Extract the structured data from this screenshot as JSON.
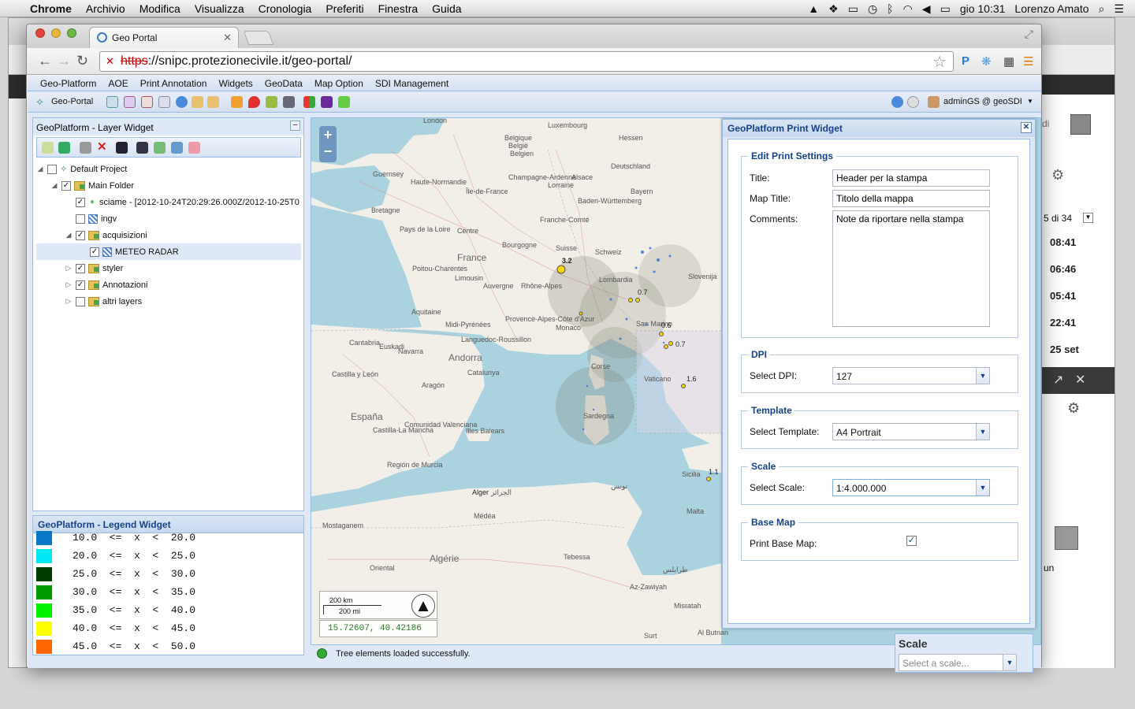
{
  "macmenu": {
    "app": "Chrome",
    "items": [
      "Archivio",
      "Modifica",
      "Visualizza",
      "Cronologia",
      "Preferiti",
      "Finestra",
      "Guida"
    ],
    "clock": "gio 10:31",
    "user": "Lorenzo Amato"
  },
  "browser": {
    "tab_title": "Geo Portal",
    "url_scheme": "https",
    "url_rest": "://snipc.protezionecivile.it/geo-portal/"
  },
  "menubar": [
    "Geo-Platform",
    "AOE",
    "Print Annotation",
    "Widgets",
    "GeoData",
    "Map Option",
    "SDI Management"
  ],
  "toolbar": {
    "home_label": "Geo-Portal",
    "user_label": "adminGS @ geoSDI"
  },
  "layer_widget": {
    "title": "GeoPlatform - Layer Widget",
    "tree": [
      {
        "label": "Default Project",
        "level": 0,
        "expanded": true,
        "checked": false,
        "kind": "project"
      },
      {
        "label": "Main Folder",
        "level": 1,
        "expanded": true,
        "checked": true,
        "kind": "folder"
      },
      {
        "label": "sciame - [2012-10-24T20:29:26.000Z/2012-10-25T0",
        "level": 2,
        "checked": true,
        "kind": "point"
      },
      {
        "label": "ingv",
        "level": 2,
        "checked": false,
        "kind": "layer"
      },
      {
        "label": "acquisizioni",
        "level": 2,
        "expanded": true,
        "checked": true,
        "kind": "folder"
      },
      {
        "label": "METEO RADAR",
        "level": 3,
        "checked": true,
        "kind": "layer",
        "selected": true
      },
      {
        "label": "styler",
        "level": 2,
        "expanded": false,
        "checked": true,
        "kind": "folder"
      },
      {
        "label": "Annotazioni",
        "level": 2,
        "expanded": false,
        "checked": true,
        "kind": "folder"
      },
      {
        "label": "altri layers",
        "level": 2,
        "expanded": false,
        "checked": false,
        "kind": "folder"
      }
    ]
  },
  "legend": {
    "title": "GeoPlatform - Legend Widget",
    "rows": [
      {
        "text": "10.0  <=  x  <  20.0",
        "color": "#0a78c8"
      },
      {
        "text": "20.0  <=  x  <  25.0",
        "color": "#00e8f8"
      },
      {
        "text": "25.0  <=  x  <  30.0",
        "color": "#003c00"
      },
      {
        "text": "30.0  <=  x  <  35.0",
        "color": "#009a00"
      },
      {
        "text": "35.0  <=  x  <  40.0",
        "color": "#00f000"
      },
      {
        "text": "40.0  <=  x  <  45.0",
        "color": "#ffff00"
      },
      {
        "text": "45.0  <=  x  <  50.0",
        "color": "#ff6600"
      }
    ]
  },
  "map": {
    "coords": "15.72607, 40.42186",
    "scale_km": "200 km",
    "scale_mi": "200 mi",
    "labels": [
      "London",
      "Belgique",
      "België",
      "Belgien",
      "Guernsey",
      "Bretagne",
      "France",
      "Pays de la Loire",
      "Centre",
      "Bourgogne",
      "Limousin",
      "Aquitaine",
      "Auvergne",
      "Midi-Pyrénées",
      "Rhône-Alpes",
      "Provence-Alpes-Côte d'Azur",
      "Monaco",
      "Andorra",
      "Catalunya",
      "Cantabria",
      "Euskadi",
      "Navarra",
      "Castilla y León",
      "Aragón",
      "España",
      "Comunidad Valenciana",
      "Illes Balears",
      "Castilla-La Mancha",
      "Región de Murcia",
      "Corse",
      "Sardegna",
      "Lombardia",
      "Bayern",
      "Deutschland",
      "Suisse",
      "Schweiz",
      "Slovenija",
      "San Marino",
      "Vaticano",
      "Sicilia",
      "Malta",
      "Alger",
      "الجزائر",
      "تونس",
      "Algérie",
      "Tebessa",
      "Mostaganem",
      "Oriental",
      "Médéa",
      "Az-Zawiyah",
      "طرابلس",
      "Misratah",
      "Surt",
      "Al Butnan",
      "Baden-Württemberg",
      "Luxembourg",
      "Hessen",
      "Haute-Normandie",
      "Île-de-France",
      "Champagne-Ardenne",
      "Lorraine",
      "Alsace",
      "Franche-Comté",
      "Poitou-Charentes",
      "Languedoc-Roussillon"
    ],
    "quakes": [
      "3.2",
      "0.7",
      "0.6",
      "0.7",
      "1.6",
      "1.1"
    ]
  },
  "print_widget": {
    "title": "GeoPlatform Print Widget",
    "edit_legend": "Edit Print Settings",
    "title_label": "Title:",
    "title_value": "Header per la stampa",
    "maptitle_label": "Map Title:",
    "maptitle_value": "Titolo della mappa",
    "comments_label": "Comments:",
    "comments_value": "Note da riportare nella stampa",
    "dpi_legend": "DPI",
    "dpi_label": "Select DPI:",
    "dpi_value": "127",
    "template_legend": "Template",
    "template_label": "Select Template:",
    "template_value": "A4 Portrait",
    "scale_legend": "Scale",
    "scale_label": "Select Scale:",
    "scale_value": "1:4.000.000",
    "basemap_legend": "Base Map",
    "basemap_label": "Print Base Map:",
    "basemap_checked": true
  },
  "scale_panel": {
    "title": "Scale",
    "placeholder": "Select a scale..."
  },
  "status": "Tree elements loaded successfully.",
  "gmail": {
    "count": "5 di 34",
    "times": [
      "08:41",
      "06:46",
      "05:41",
      "22:41",
      "25 set"
    ],
    "un": "un",
    "di": "di"
  }
}
